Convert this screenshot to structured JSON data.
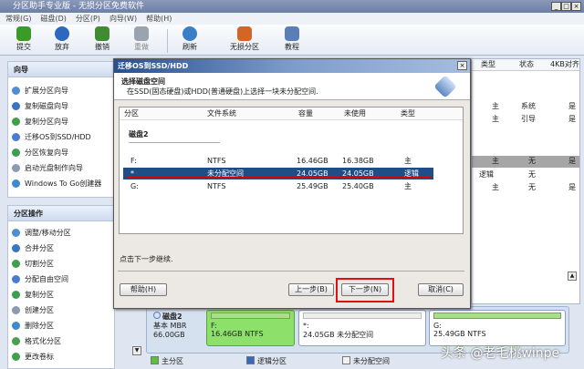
{
  "window": {
    "title": "分区助手专业版 - 无损分区免费软件",
    "min": "_",
    "max": "□",
    "close": "×"
  },
  "menu": [
    "常规(G)",
    "磁盘(D)",
    "分区(P)",
    "向导(W)",
    "帮助(H)"
  ],
  "toolbar": [
    {
      "label": "提交",
      "icon": "check-icon",
      "color": "#3a9a2a"
    },
    {
      "label": "放弃",
      "icon": "discard-icon",
      "color": "#2c68c0"
    },
    {
      "label": "撤销",
      "icon": "undo-icon",
      "color": "#3f8c33"
    },
    {
      "label": "重做",
      "icon": "redo-icon",
      "color": "#9aa4b0"
    },
    {
      "label": "刷新",
      "icon": "refresh-icon",
      "color": "#3b7ec8"
    },
    {
      "label": "无损分区",
      "icon": "partition-icon",
      "color": "#d2652a"
    },
    {
      "label": "教程",
      "icon": "tutorial-icon",
      "color": "#5a7fb6"
    }
  ],
  "wizard": {
    "title": "向导",
    "items": [
      "扩展分区向导",
      "复制磁盘向导",
      "复制分区向导",
      "迁移OS到SSD/HDD",
      "分区恢复向导",
      "启动光盘制作向导",
      "Windows To Go创建器"
    ]
  },
  "operations": {
    "title": "分区操作",
    "items": [
      "调整/移动分区",
      "合并分区",
      "切割分区",
      "分配自由空间",
      "复制分区",
      "创建分区",
      "删除分区",
      "格式化分区",
      "更改卷标"
    ]
  },
  "dialog": {
    "title": "迁移OS到SSD/HDD",
    "close": "×",
    "heading": "选择磁盘空间",
    "subheading": "在SSD(固态硬盘)或HDD(普通硬盘)上选择一块未分配空间.",
    "columns": [
      "分区",
      "文件系统",
      "容量",
      "未使用",
      "类型"
    ],
    "disk_label": "磁盘2",
    "rows": [
      {
        "partition": "F:",
        "fs": "NTFS",
        "capacity": "16.46GB",
        "free": "16.38GB",
        "type": "主"
      },
      {
        "partition": "*",
        "fs": "未分配空间",
        "capacity": "24.05GB",
        "free": "24.05GB",
        "type": "逻辑",
        "selected": true
      },
      {
        "partition": "G:",
        "fs": "NTFS",
        "capacity": "25.49GB",
        "free": "25.40GB",
        "type": "主"
      }
    ],
    "status": "点击下一步继续.",
    "buttons": {
      "help": "帮助(H)",
      "back": "上一步(B)",
      "next": "下一步(N)",
      "cancel": "取消(C)"
    }
  },
  "right_table": {
    "columns": [
      "类型",
      "状态",
      "4KB对齐"
    ],
    "rows": [
      [
        "主",
        "系统",
        "是"
      ],
      [
        "主",
        "引导",
        "是"
      ],
      [
        "主",
        "无",
        "是"
      ],
      [
        "逻辑",
        "无",
        ""
      ],
      [
        "主",
        "无",
        "是"
      ]
    ]
  },
  "diskmap": {
    "name": "磁盘2",
    "kind": "基本 MBR",
    "size": "66.00GB",
    "parts": [
      {
        "label": "F:",
        "desc": "16.46GB NTFS"
      },
      {
        "label": "*:",
        "desc": "24.05GB 未分配空间"
      },
      {
        "label": "G:",
        "desc": "25.49GB NTFS"
      }
    ]
  },
  "legend": [
    "主分区",
    "逻辑分区",
    "未分配空间"
  ],
  "watermark": "头条 @老毛桃winpe"
}
